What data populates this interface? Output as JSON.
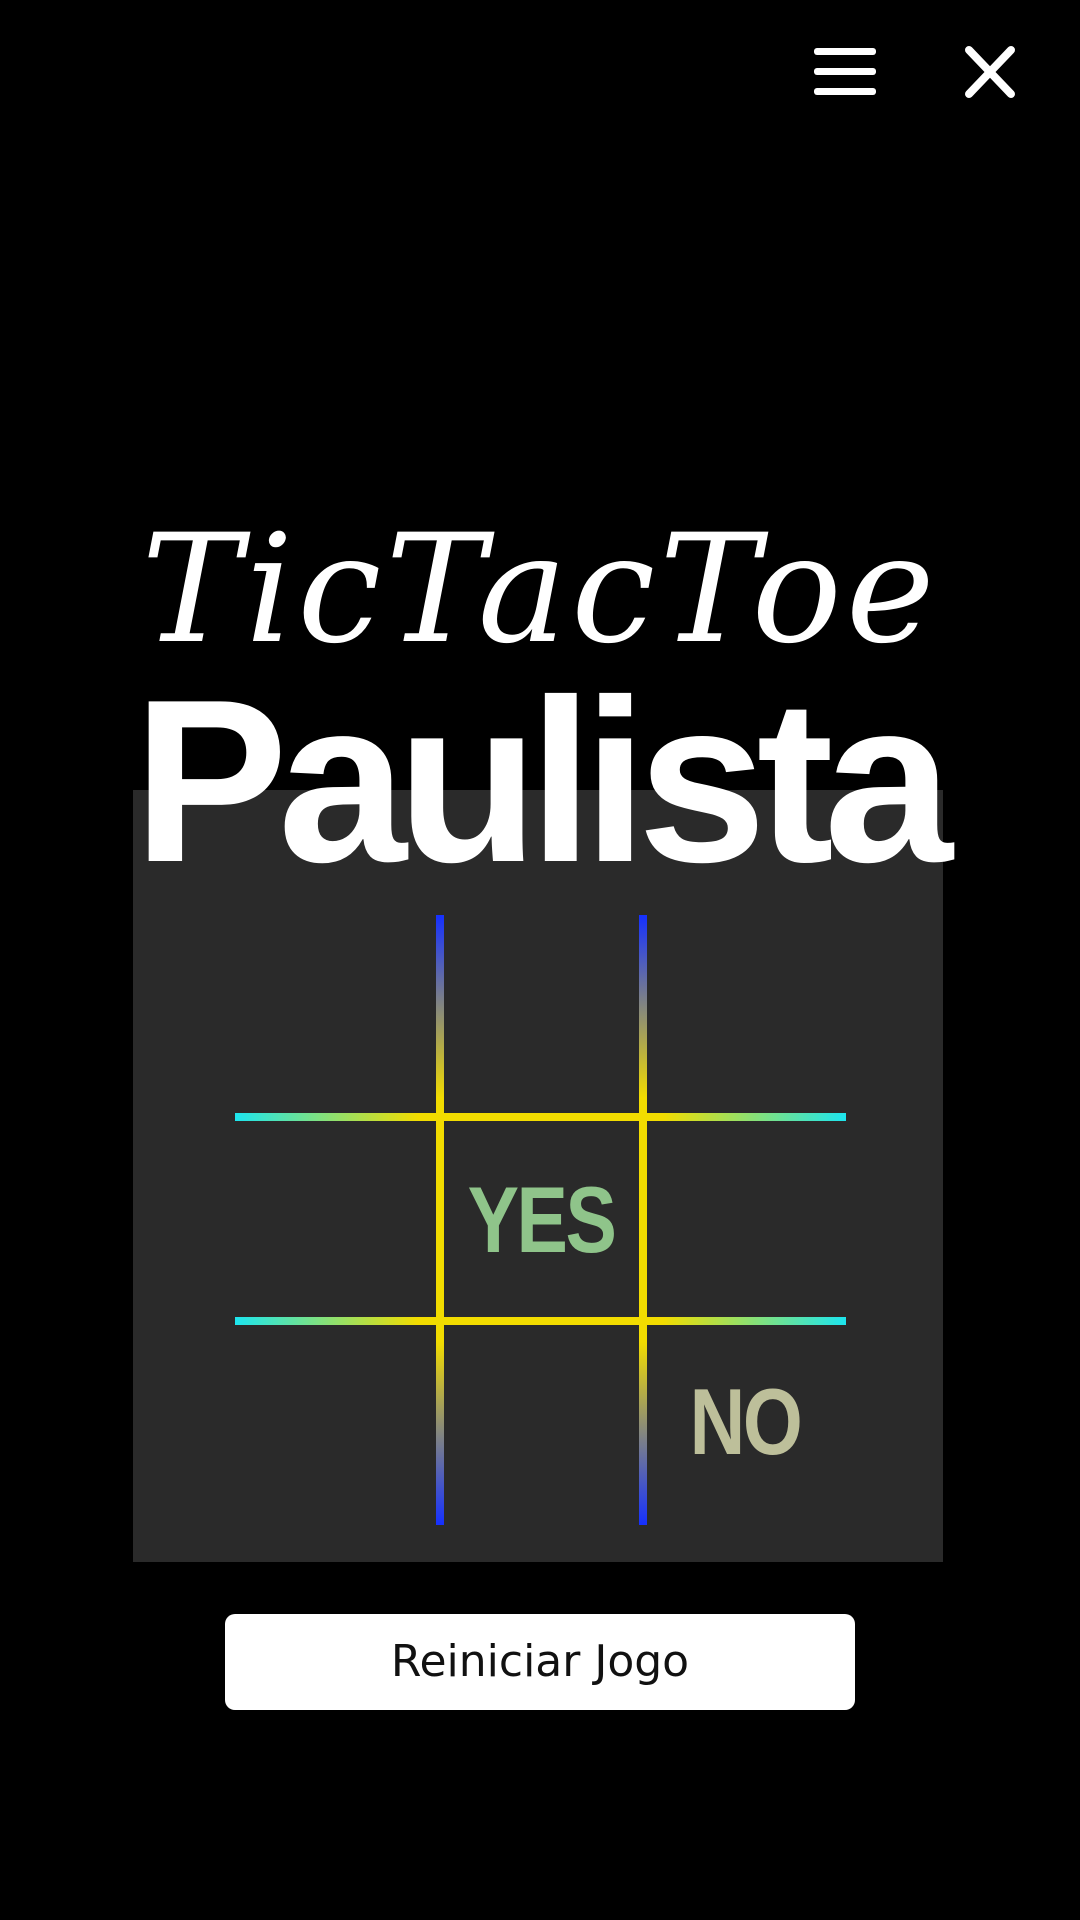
{
  "header": {
    "menu_icon": "hamburger-menu-icon",
    "close_icon": "close-icon"
  },
  "title": {
    "script_text": "TicTacToe",
    "main_text": "Paulista"
  },
  "board": {
    "colors": {
      "panel": "#2a2a2a",
      "grid_center": "#f2dc00",
      "grid_vertical_end": "#1530ff",
      "grid_horizontal_end": "#1de5ee",
      "yes_mark": "#8fc48a",
      "no_mark": "#bdbf9a"
    },
    "cells": [
      {
        "row": 1,
        "col": 1,
        "value": ""
      },
      {
        "row": 1,
        "col": 2,
        "value": ""
      },
      {
        "row": 1,
        "col": 3,
        "value": ""
      },
      {
        "row": 2,
        "col": 1,
        "value": ""
      },
      {
        "row": 2,
        "col": 2,
        "value": "YES"
      },
      {
        "row": 2,
        "col": 3,
        "value": ""
      },
      {
        "row": 3,
        "col": 1,
        "value": ""
      },
      {
        "row": 3,
        "col": 2,
        "value": ""
      },
      {
        "row": 3,
        "col": 3,
        "value": "NO"
      }
    ]
  },
  "actions": {
    "restart_label": "Reiniciar Jogo"
  }
}
